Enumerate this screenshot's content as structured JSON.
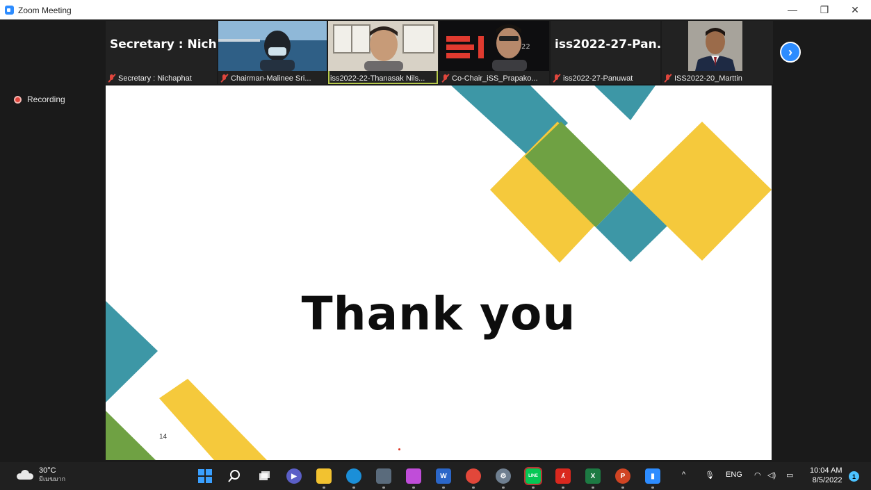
{
  "window": {
    "title": "Zoom Meeting",
    "minimize_glyph": "—",
    "restore_glyph": "❐",
    "close_glyph": "✕"
  },
  "participants": [
    {
      "display": "namecard",
      "namecard_text": "Secretary : Nich...",
      "label": "Secretary : Nichaphat",
      "muted": true
    },
    {
      "display": "video",
      "label": "Chairman-Malinee Sri...",
      "muted": true
    },
    {
      "display": "video",
      "label": "iss2022-22-Thanasak Nils...",
      "muted": false,
      "active_speaker": true
    },
    {
      "display": "video",
      "label": "Co-Chair_iSS_Prapako...",
      "muted": true
    },
    {
      "display": "namecard",
      "namecard_text": "iss2022-27-Pan...",
      "label": "iss2022-27-Panuwat",
      "muted": true
    },
    {
      "display": "video",
      "label": "ISS2022-20_Marttin",
      "muted": true
    }
  ],
  "next_page_glyph": "›",
  "recording": {
    "label": "Recording"
  },
  "slide": {
    "heading": "Thank you",
    "page_number": "14",
    "colors": {
      "teal": "#3d97a6",
      "green": "#6fa143",
      "yellow": "#f5c93c"
    }
  },
  "taskbar": {
    "weather": {
      "temp": "30°C",
      "condition": "มีเมฆมาก"
    },
    "apps": [
      {
        "name": "start-icon"
      },
      {
        "name": "search-icon"
      },
      {
        "name": "task-view-icon"
      },
      {
        "name": "teams-chat-icon"
      },
      {
        "name": "file-explorer-icon"
      },
      {
        "name": "edge-icon"
      },
      {
        "name": "calculator-icon"
      },
      {
        "name": "snipping-tool-icon"
      },
      {
        "name": "word-icon",
        "text": "W"
      },
      {
        "name": "chrome-icon"
      },
      {
        "name": "settings-icon"
      },
      {
        "name": "line-icon",
        "text": "LINE"
      },
      {
        "name": "acrobat-icon"
      },
      {
        "name": "excel-icon",
        "text": "X"
      },
      {
        "name": "powerpoint-icon",
        "text": "P"
      },
      {
        "name": "zoom-icon"
      }
    ],
    "tray": {
      "language": "ENG",
      "chevron": "^"
    },
    "clock": {
      "time": "10:04 AM",
      "date": "8/5/2022"
    },
    "notifications": "1"
  }
}
